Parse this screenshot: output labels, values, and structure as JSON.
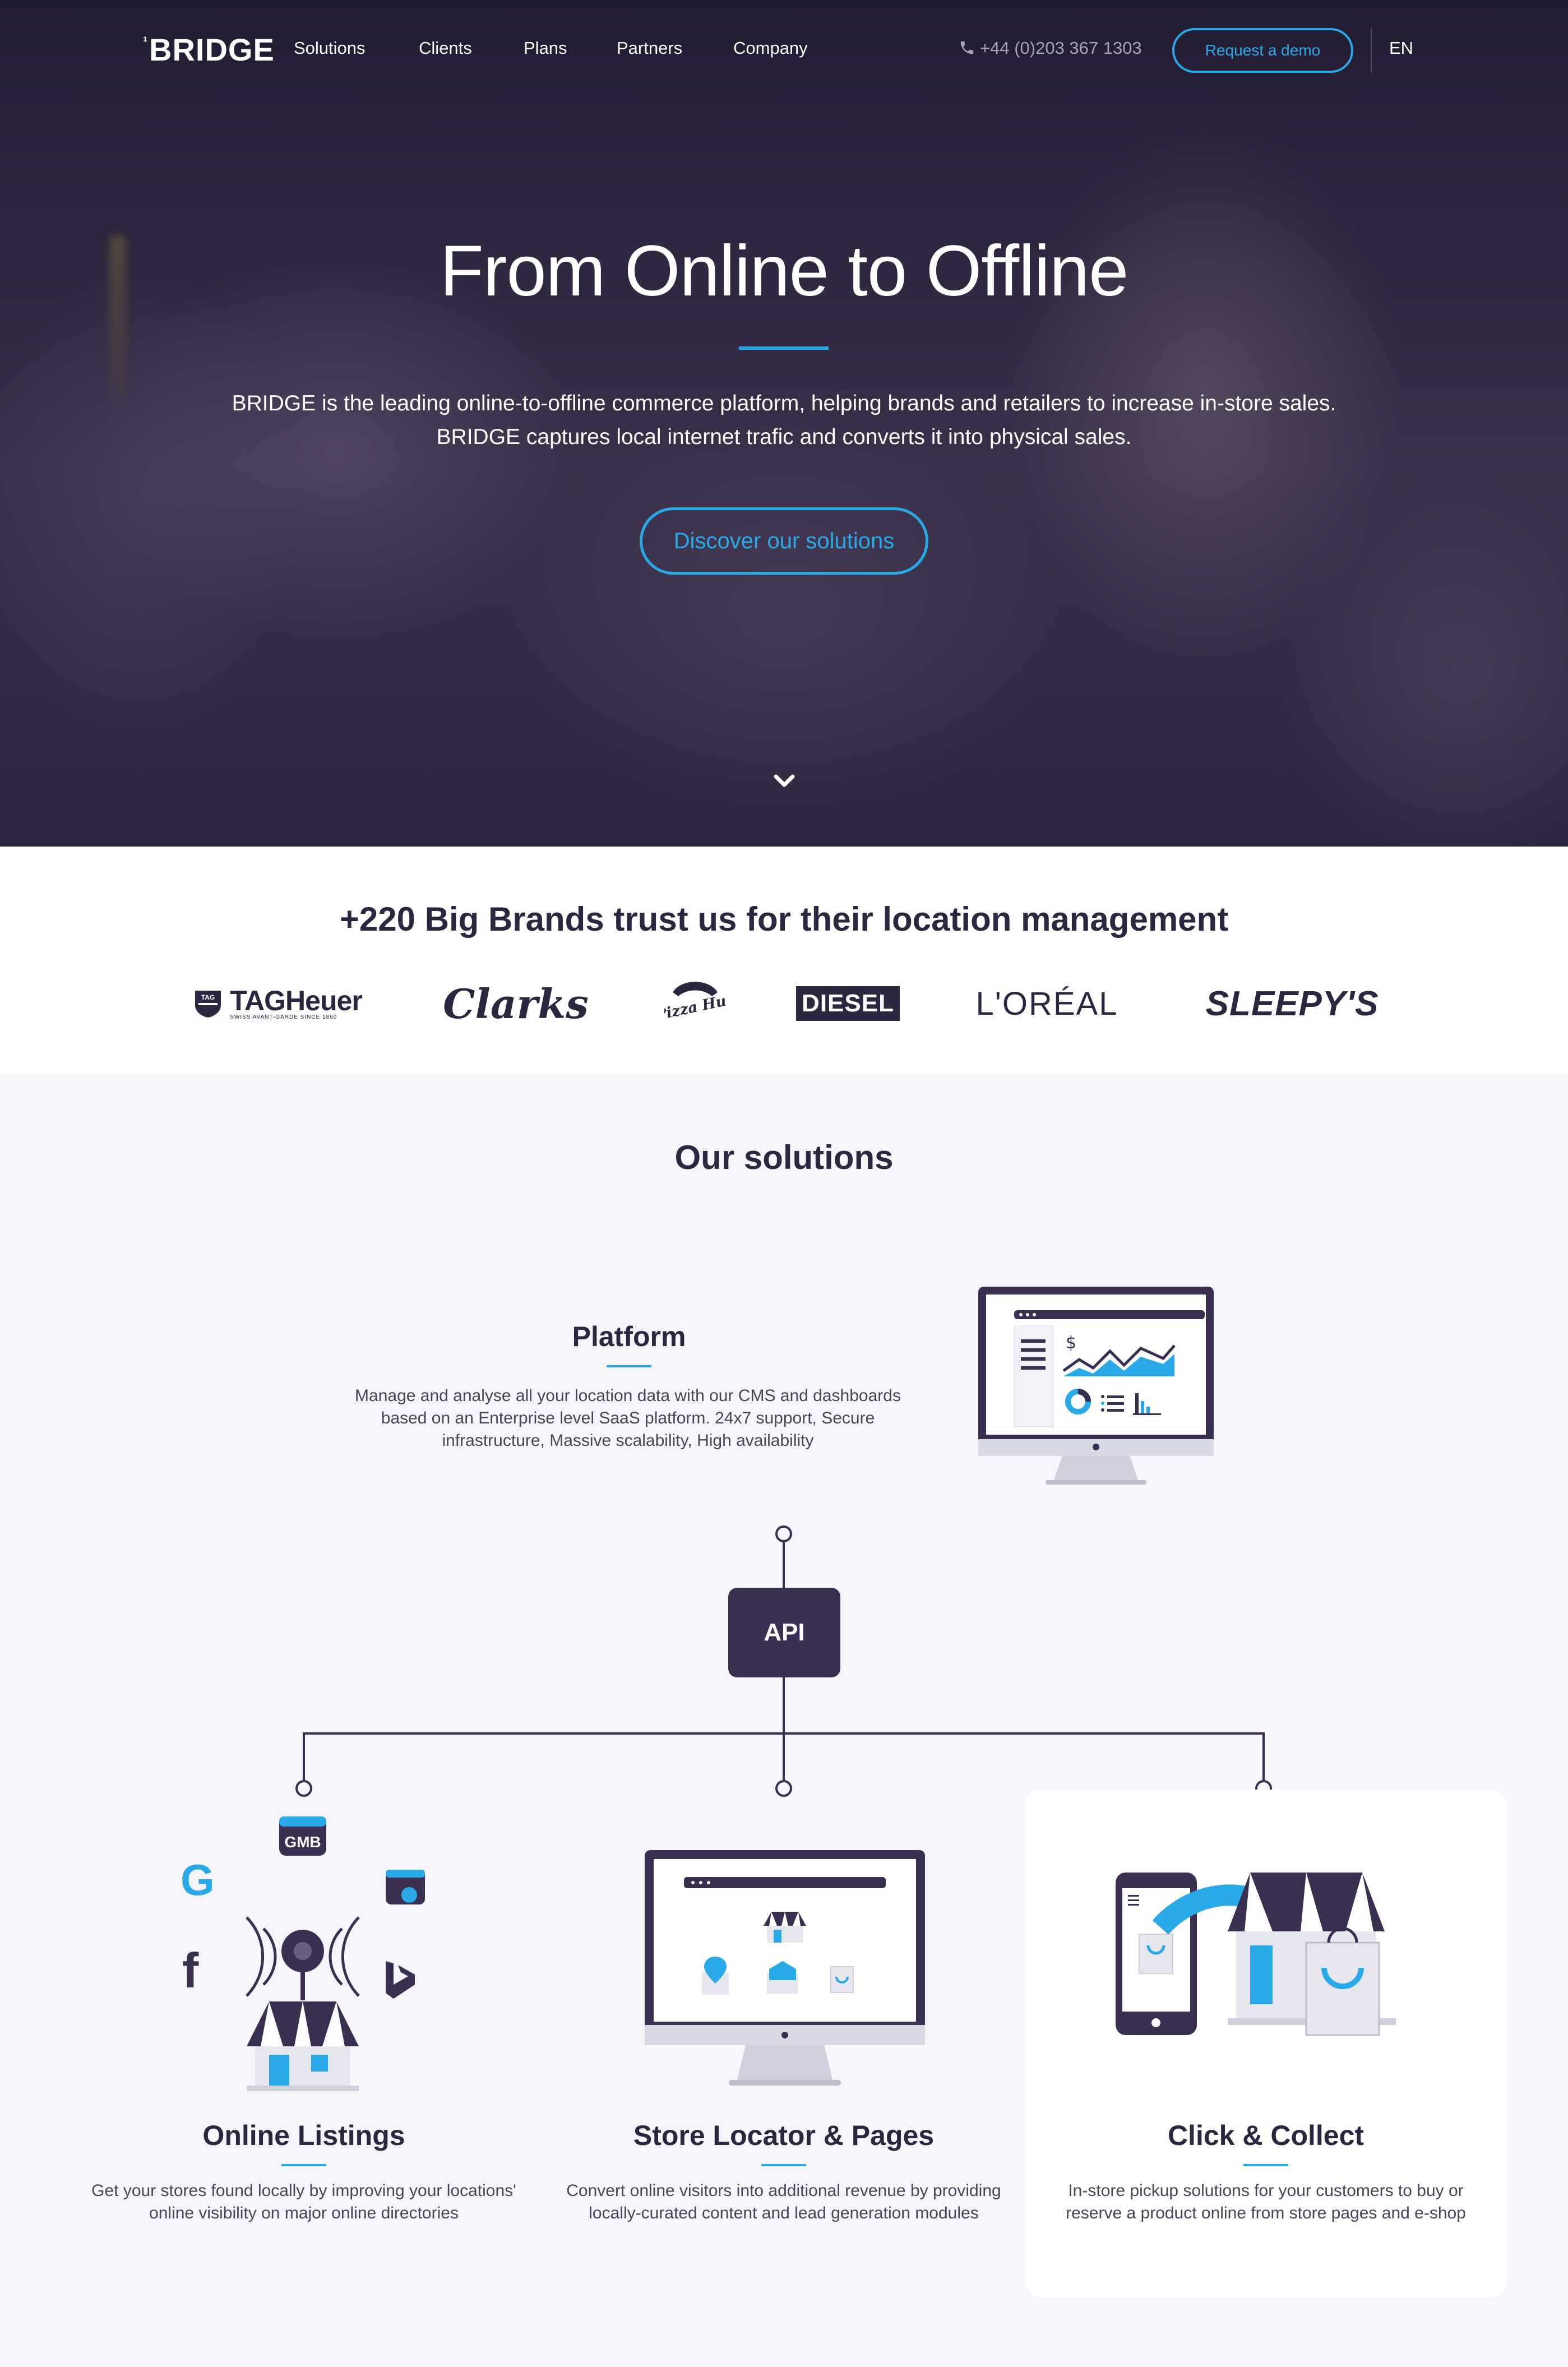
{
  "nav": {
    "logo": "BRIDGE",
    "logo_mark": "¹",
    "links": [
      "Solutions",
      "Clients",
      "Plans",
      "Partners",
      "Company"
    ],
    "phone": "+44 (0)203 367 1303",
    "demo_button": "Request a demo",
    "language": "EN"
  },
  "hero": {
    "title": "From Online to Offline",
    "subtitle": "BRIDGE is the leading online-to-offline commerce platform, helping brands and retailers to increase in-store sales. BRIDGE captures local internet trafic and converts it into physical sales.",
    "cta": "Discover our solutions"
  },
  "brands": {
    "title": "+220 Big Brands trust us for their location management",
    "logos": {
      "tagheuer": "TAGHeuer",
      "tagheuer_sub": "SWISS AVANT-GARDE SINCE 1860",
      "tag_shield": "TAG",
      "clarks": "Clarks",
      "pizzahut": "Pizza Hut",
      "diesel": "DIESEL",
      "loreal": "L'ORÉAL",
      "sleepys": "SLEEPY'S"
    }
  },
  "solutions": {
    "title": "Our solutions",
    "platform": {
      "title": "Platform",
      "description": "Manage and analyse all your location data with our CMS and dashboards based on an Enterprise level SaaS platform. 24x7 support, Secure infrastructure, Massive scalability, High availability"
    },
    "api_label": "API",
    "gmb_label": "GMB",
    "items": [
      {
        "title": "Online Listings",
        "description": "Get your stores found locally by improving your locations' online visibility on major online directories"
      },
      {
        "title": "Store Locator & Pages",
        "description": "Convert online visitors into additional revenue by providing locally-curated content and lead generation modules"
      },
      {
        "title": "Click & Collect",
        "description": "In-store pickup solutions for your customers to buy or reserve a product online from store pages and e-shop"
      }
    ]
  },
  "colors": {
    "accent": "#2aa9e8",
    "dark": "#3b2f51",
    "text": "#2d2640",
    "background": "#f5f5fb"
  }
}
